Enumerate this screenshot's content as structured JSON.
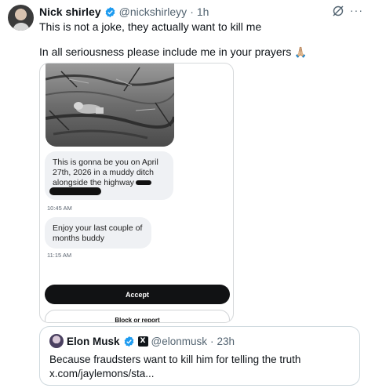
{
  "tweet": {
    "author_name": "Nick shirley",
    "handle": "@nickshirleyy",
    "separator": "·",
    "time": "1h",
    "line1": "This is not a joke, they actually want to kill me",
    "line2": "In all seriousness please include me in your prayers",
    "line2_emoji": "🙏🏼",
    "more_label": "···"
  },
  "screenshot": {
    "message1_lines": [
      "This is gonna be you on April",
      "27th, 2026 in a  muddy ditch",
      "alongside the highway"
    ],
    "message1_time": "10:45 AM",
    "message2_lines": [
      "Enjoy your last couple of",
      "months buddy"
    ],
    "message2_time": "11:15 AM",
    "accept_label": "Accept",
    "block_label": "Block or report"
  },
  "quote": {
    "author_name": "Elon Musk",
    "badge": "X",
    "handle": "@elonmusk",
    "separator": "·",
    "time": "23h",
    "line1": "Because fraudsters want to kill him for telling the truth",
    "line2": "x.com/jaylemons/sta..."
  },
  "colors": {
    "verified_blue": "#1d9bf0",
    "secondary_text": "#536471",
    "accept_button": "#111214"
  }
}
